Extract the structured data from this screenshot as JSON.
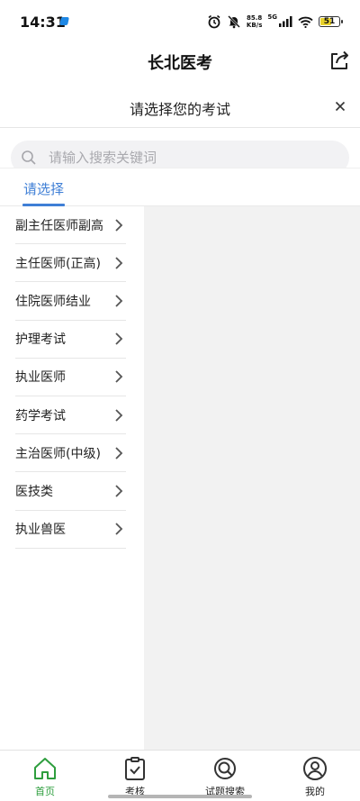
{
  "status_bar": {
    "time": "14:31",
    "net_speed_value": "85.8",
    "net_speed_unit": "KB/s",
    "network_type": "5G",
    "battery_level": "51"
  },
  "header": {
    "title": "长北医考"
  },
  "modal": {
    "title": "请选择您的考试"
  },
  "search": {
    "placeholder": "请输入搜索关键词"
  },
  "tabs": [
    {
      "label": "请选择"
    }
  ],
  "categories": [
    {
      "label": "副主任医师副高"
    },
    {
      "label": "主任医师(正高)"
    },
    {
      "label": "住院医师结业"
    },
    {
      "label": "护理考试"
    },
    {
      "label": "执业医师"
    },
    {
      "label": "药学考试"
    },
    {
      "label": "主治医师(中级)"
    },
    {
      "label": "医技类"
    },
    {
      "label": "执业兽医"
    }
  ],
  "bottom_nav": [
    {
      "label": "首页",
      "icon": "home-icon",
      "active": true
    },
    {
      "label": "考核",
      "icon": "clipboard-check-icon",
      "active": false
    },
    {
      "label": "试题搜索",
      "icon": "search-q-icon",
      "active": false
    },
    {
      "label": "我的",
      "icon": "user-icon",
      "active": false
    }
  ],
  "colors": {
    "accent": "#3f7fd6",
    "nav_active": "#2e9e3e",
    "pane_bg": "#f2f2f2"
  }
}
